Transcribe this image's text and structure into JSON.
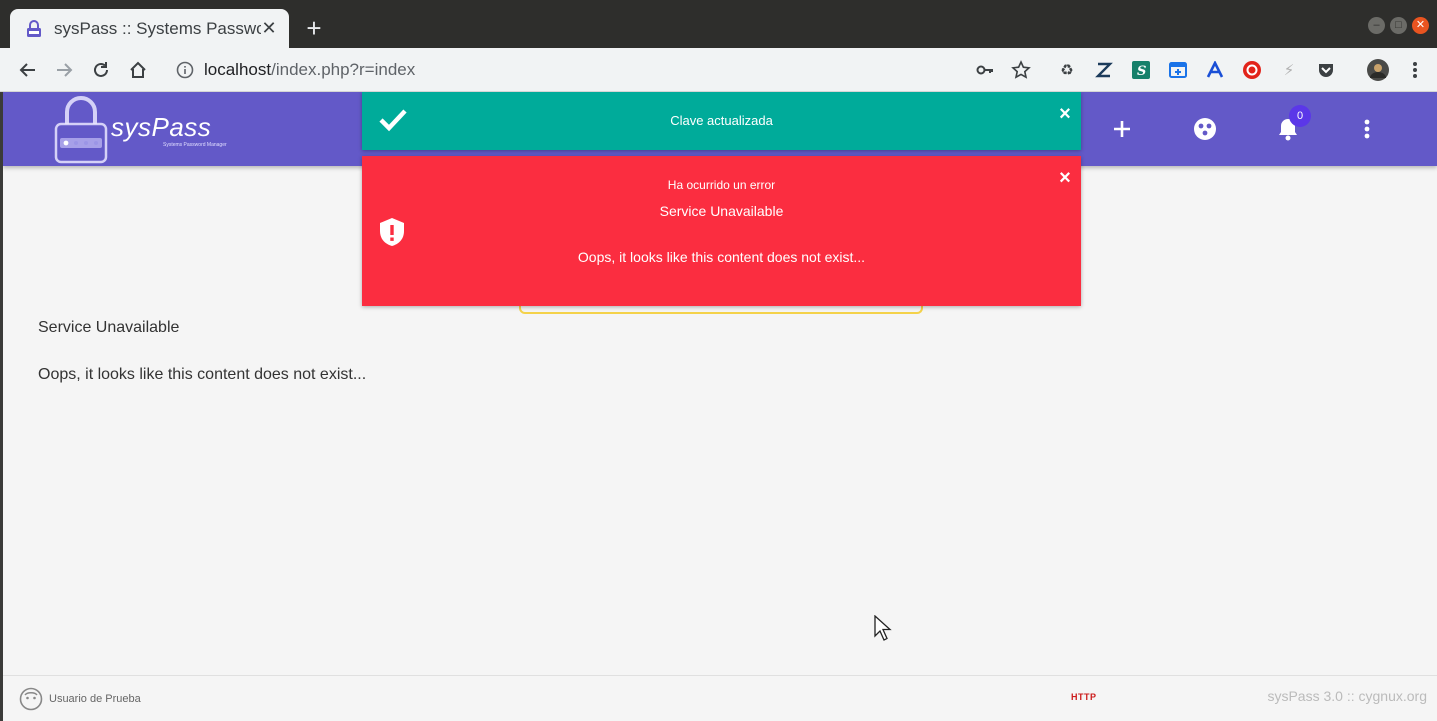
{
  "browser": {
    "tab_title": "sysPass :: Systems Passwo",
    "url_host": "localhost",
    "url_path": "/index.php?r=index"
  },
  "app": {
    "brand": "sysPass",
    "tagline": "Systems Password Manager",
    "notifications_count": "0",
    "theme_color": "#6359c8"
  },
  "toasts": {
    "success": {
      "message": "Clave actualizada",
      "close": "×",
      "color": "#00ab9a"
    },
    "error": {
      "heading": "Ha ocurrido un error",
      "title": "Service Unavailable",
      "detail": "Oops, it looks like this content does not exist...",
      "close": "×",
      "color": "#fb2d40"
    }
  },
  "content": {
    "title": "Service Unavailable",
    "message": "Oops, it looks like this content does not exist..."
  },
  "footer": {
    "user": "Usuario de Prueba",
    "protocol": "HTTP",
    "version": "sysPass 3.0  ::  cygnux.org"
  }
}
